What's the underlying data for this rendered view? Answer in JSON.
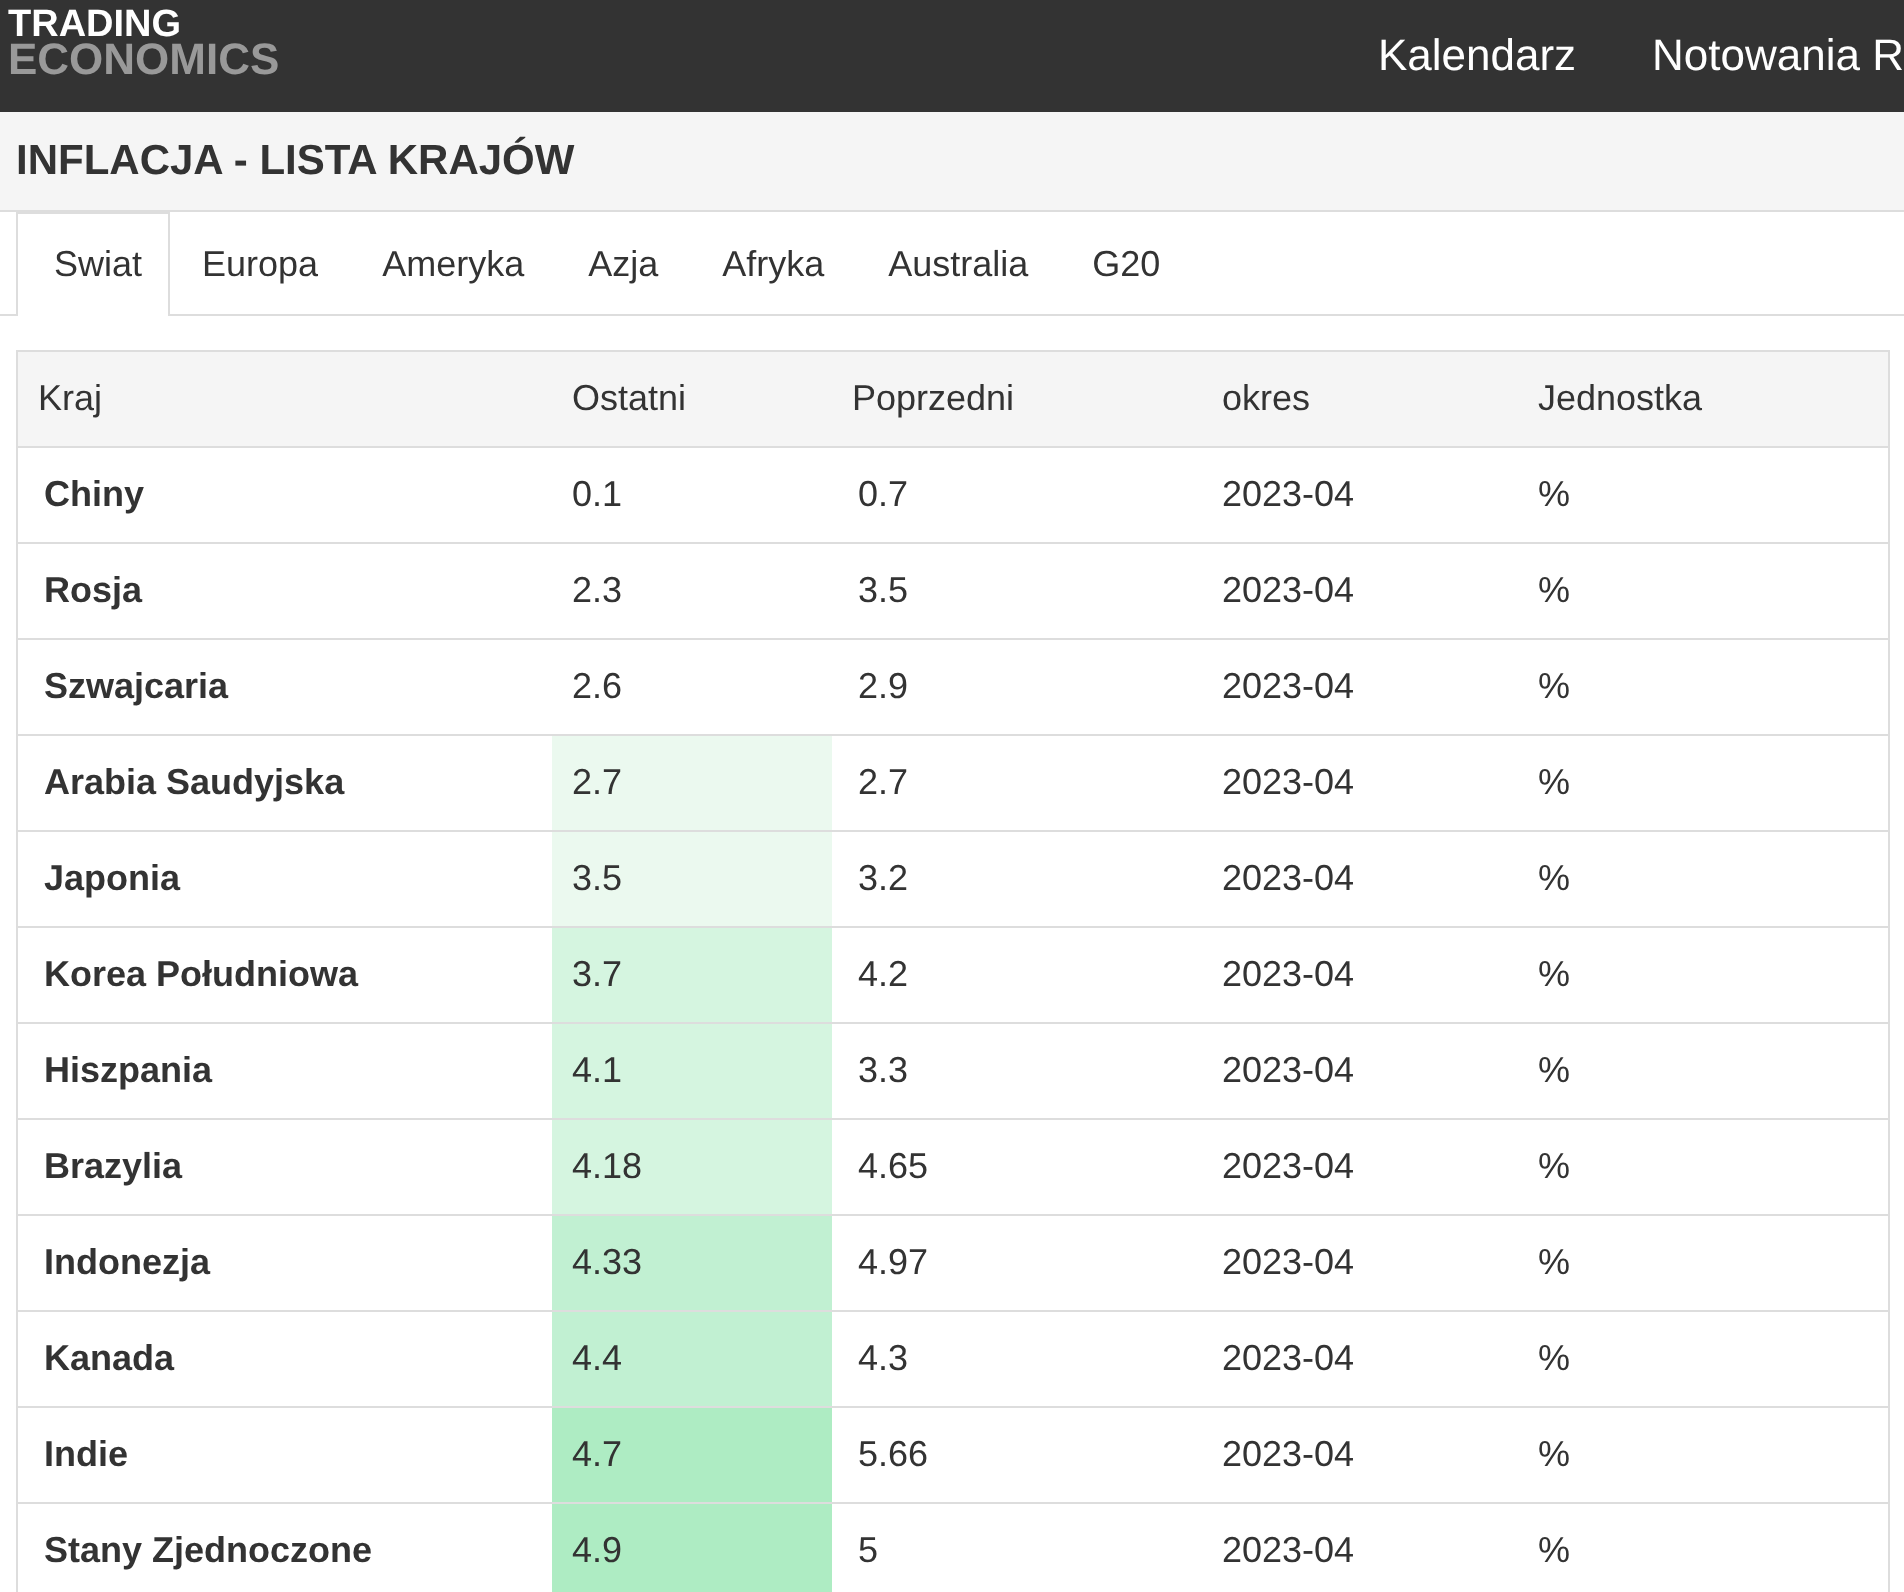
{
  "logo": {
    "line_1": "TRADING",
    "line_2": "ECONOMICS"
  },
  "nav": [
    "Kalendarz",
    "Notowania R"
  ],
  "title": "INFLACJA - LISTA KRAJÓW",
  "tabs": [
    {
      "label": "Swiat",
      "selected": true
    },
    {
      "label": "Europa",
      "selected": false
    },
    {
      "label": "Ameryka",
      "selected": false
    },
    {
      "label": "Azja",
      "selected": false
    },
    {
      "label": "Afryka",
      "selected": false
    },
    {
      "label": "Australia",
      "selected": false
    },
    {
      "label": "G20",
      "selected": false
    }
  ],
  "table": {
    "columns": [
      "Kraj",
      "Ostatni",
      "Poprzedni",
      "okres",
      "Jednostka"
    ],
    "rows": [
      {
        "country": "Chiny",
        "last": "0.1",
        "previous": "0.7",
        "period": "2023-04",
        "unit": "%",
        "color": "#ffffff"
      },
      {
        "country": "Rosja",
        "last": "2.3",
        "previous": "3.5",
        "period": "2023-04",
        "unit": "%",
        "color": "#ffffff"
      },
      {
        "country": "Szwajcaria",
        "last": "2.6",
        "previous": "2.9",
        "period": "2023-04",
        "unit": "%",
        "color": "#ffffff"
      },
      {
        "country": "Arabia Saudyjska",
        "last": "2.7",
        "previous": "2.7",
        "period": "2023-04",
        "unit": "%",
        "color": "#ebf9ef"
      },
      {
        "country": "Japonia",
        "last": "3.5",
        "previous": "3.2",
        "period": "2023-04",
        "unit": "%",
        "color": "#ebf9ef"
      },
      {
        "country": "Korea Południowa",
        "last": "3.7",
        "previous": "4.2",
        "period": "2023-04",
        "unit": "%",
        "color": "#d5f5e0"
      },
      {
        "country": "Hiszpania",
        "last": "4.1",
        "previous": "3.3",
        "period": "2023-04",
        "unit": "%",
        "color": "#d5f5e0"
      },
      {
        "country": "Brazylia",
        "last": "4.18",
        "previous": "4.65",
        "period": "2023-04",
        "unit": "%",
        "color": "#d5f5e0"
      },
      {
        "country": "Indonezja",
        "last": "4.33",
        "previous": "4.97",
        "period": "2023-04",
        "unit": "%",
        "color": "#c1f0d2"
      },
      {
        "country": "Kanada",
        "last": "4.4",
        "previous": "4.3",
        "period": "2023-04",
        "unit": "%",
        "color": "#c1f0d2"
      },
      {
        "country": "Indie",
        "last": "4.7",
        "previous": "5.66",
        "period": "2023-04",
        "unit": "%",
        "color": "#aeecc3"
      },
      {
        "country": "Stany Zjednoczone",
        "last": "4.9",
        "previous": "5",
        "period": "2023-04",
        "unit": "%",
        "color": "#aeecc3"
      }
    ]
  }
}
